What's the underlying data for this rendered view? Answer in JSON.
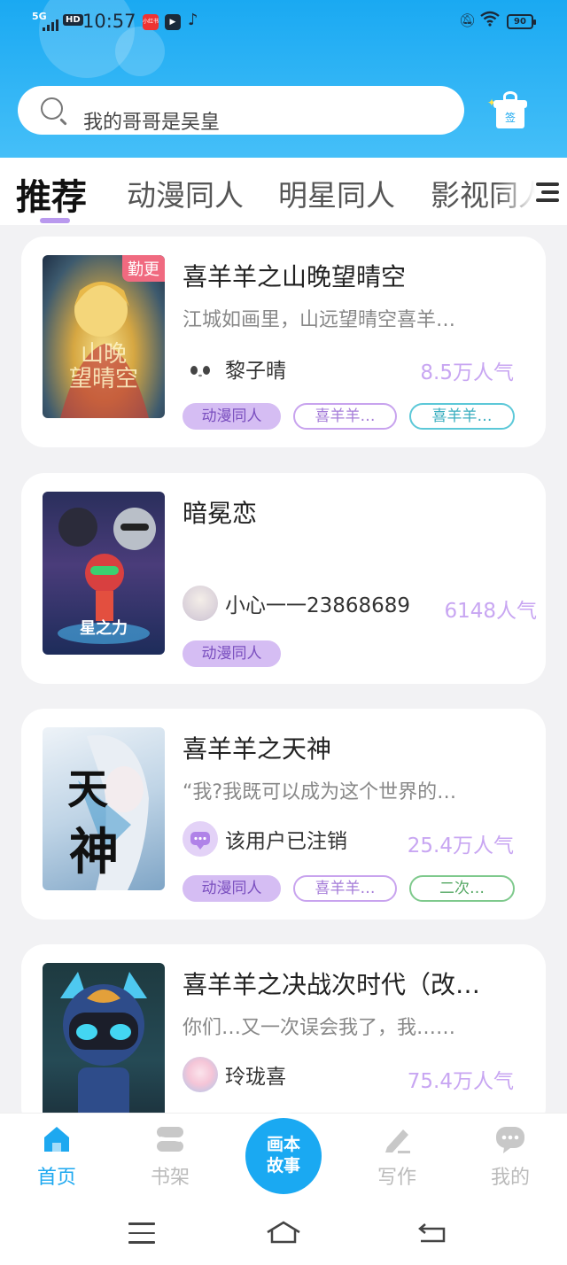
{
  "status_bar": {
    "network": "5G",
    "hd": "HD",
    "time": "10:57",
    "app_icon_1_text": "小红书",
    "battery": "90"
  },
  "search": {
    "placeholder": "我的哥哥是吴皇"
  },
  "gift": {
    "label": "签"
  },
  "tabs": [
    {
      "label": "推荐",
      "active": true
    },
    {
      "label": "动漫同人"
    },
    {
      "label": "明星同人"
    },
    {
      "label": "影视同人"
    }
  ],
  "cards": [
    {
      "badge": "勤更",
      "title": "喜羊羊之山晚望晴空",
      "description": "江城如画里，山远望晴空喜羊…",
      "author": "黎子晴",
      "popularity": "8.5万人气",
      "tags": [
        "动漫同人",
        "喜羊羊…",
        "喜羊羊…"
      ]
    },
    {
      "title": "暗冕恋",
      "author": "小心一一23868689",
      "popularity": "6148人气",
      "tags": [
        "动漫同人"
      ]
    },
    {
      "title": "喜羊羊之天神",
      "description": "“我?我既可以成为这个世界的…",
      "author": "该用户已注销",
      "popularity": "25.4万人气",
      "tags": [
        "动漫同人",
        "喜羊羊…",
        "二次…"
      ]
    },
    {
      "title": "喜羊羊之决战次时代（改…",
      "description": "你们…又一次误会我了，我……",
      "author": "玲珑喜",
      "popularity": "75.4万人气"
    }
  ],
  "bottom_nav": {
    "home": "首页",
    "bookshelf": "书架",
    "center_line1": "画本",
    "center_line2": "故事",
    "write": "写作",
    "mine": "我的"
  },
  "colors": {
    "accent": "#1aa9f2",
    "popularity": "#c8a6f2",
    "tag_fill": "#d5bdf3"
  }
}
